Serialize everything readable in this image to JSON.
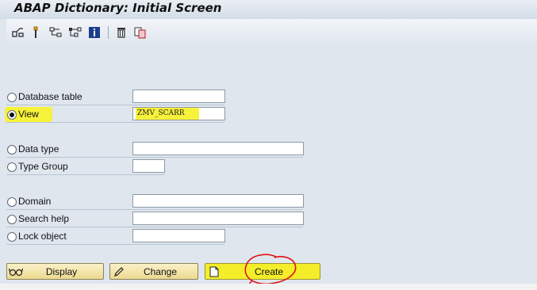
{
  "window": {
    "title": "ABAP Dictionary: Initial Screen"
  },
  "toolbar": {
    "icons": [
      "where-used-icon",
      "tools-icon",
      "hierarchy-icon",
      "object-list-icon",
      "info-icon",
      "delete-icon",
      "copy-icon"
    ]
  },
  "objects": [
    {
      "label": "Database table",
      "selected": false,
      "value": ""
    },
    {
      "label": "View",
      "selected": true,
      "value": "ZMV_SCARR"
    },
    {
      "label": "Data type",
      "selected": false,
      "value": ""
    },
    {
      "label": "Type Group",
      "selected": false,
      "value": ""
    },
    {
      "label": "Domain",
      "selected": false,
      "value": ""
    },
    {
      "label": "Search help",
      "selected": false,
      "value": ""
    },
    {
      "label": "Lock object",
      "selected": false,
      "value": ""
    }
  ],
  "buttons": {
    "display": "Display",
    "change": "Change",
    "create": "Create"
  },
  "colors": {
    "highlight": "#f7f23a",
    "annotation": "#e01010",
    "background": "#dfe6ee"
  }
}
